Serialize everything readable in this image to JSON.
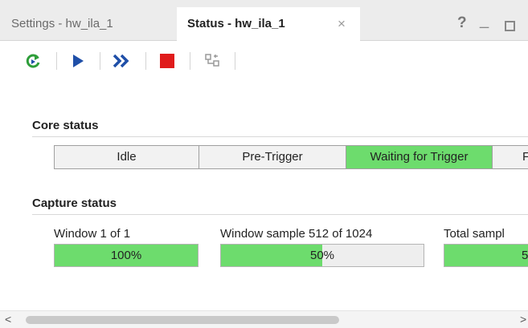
{
  "tabs": [
    {
      "label": "Settings - hw_ila_1",
      "active": false
    },
    {
      "label": "Status - hw_ila_1",
      "active": true,
      "close": "×"
    }
  ],
  "window_controls": {
    "help": "?",
    "minimize": "_",
    "maximize": ""
  },
  "toolbar": {
    "buttons": [
      {
        "name": "run-trigger-immediate",
        "icon": "refresh-run-icon",
        "color": "#2e9e3a"
      },
      {
        "name": "run-trigger",
        "icon": "play-icon",
        "color": "#1f4fa8"
      },
      {
        "name": "run-trigger-continuous",
        "icon": "double-chevron-icon",
        "color": "#1f4fa8"
      },
      {
        "name": "stop-trigger",
        "icon": "stop-icon",
        "color": "#e01b1b"
      },
      {
        "name": "export-settings",
        "icon": "tree-icon",
        "color": "#9a9a9a"
      }
    ]
  },
  "core_status": {
    "title": "Core status",
    "states": [
      {
        "label": "Idle",
        "active": false
      },
      {
        "label": "Pre-Trigger",
        "active": false
      },
      {
        "label": "Waiting for Trigger",
        "active": true
      },
      {
        "label": "F",
        "active": false
      }
    ],
    "active_color": "#6ddc6d"
  },
  "capture_status": {
    "title": "Capture status",
    "items": [
      {
        "label": "Window 1 of 1",
        "percent_text": "100%",
        "progress": 1.0
      },
      {
        "label": "Window sample 512 of 1024",
        "percent_text": "50%",
        "progress": 0.5
      },
      {
        "label": "Total sampl",
        "percent_text": "5",
        "progress": 1.0
      }
    ]
  },
  "scrollbar": {
    "left_arrow": "<",
    "right_arrow": ">"
  }
}
